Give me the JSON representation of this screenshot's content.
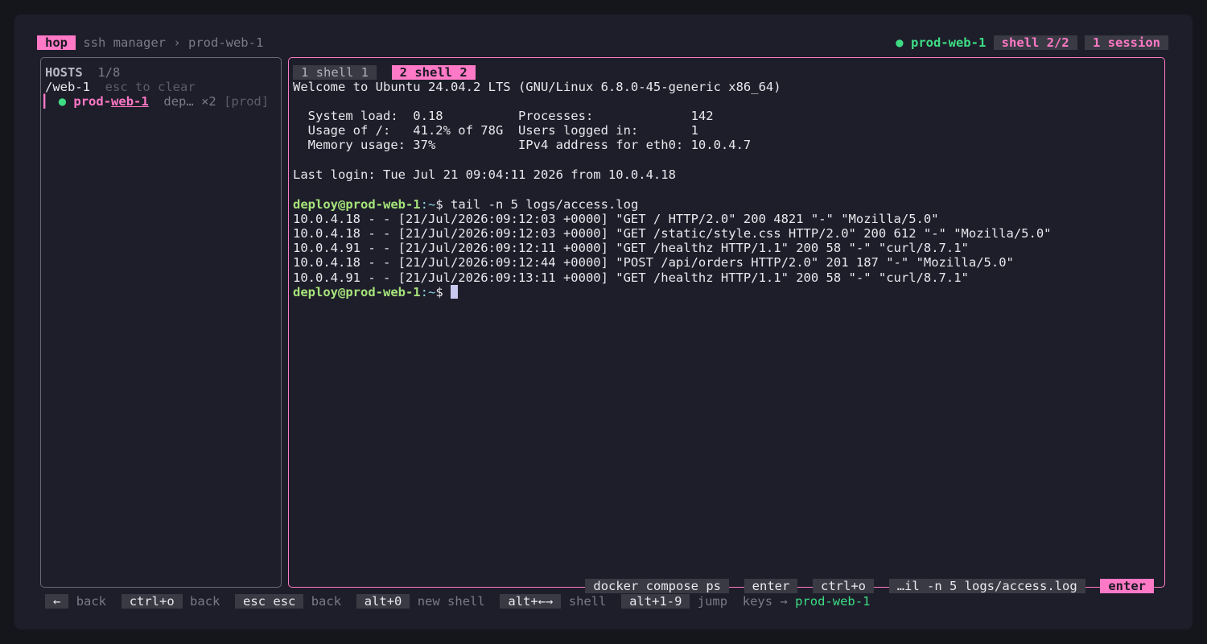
{
  "header": {
    "app_badge": "hop",
    "breadcrumb": "ssh manager › prod-web-1",
    "status_dot": "●",
    "host": "prod-web-1",
    "shell_count": "shell 2/2",
    "session_count": "1 session"
  },
  "hosts": {
    "title": "HOSTS",
    "count": "1/8",
    "filter": "/web-1",
    "filter_hint": "esc to clear",
    "items": [
      {
        "dot": "●",
        "name_prefix": "prod-",
        "name_match": "web-1",
        "user": "dep…",
        "sessions": "×2",
        "tag": "[prod]"
      }
    ]
  },
  "shells": {
    "tabs": [
      {
        "label": "1 shell 1",
        "active": false
      },
      {
        "label": "2 shell 2",
        "active": true
      }
    ]
  },
  "terminal": {
    "welcome": "Welcome to Ubuntu 24.04.2 LTS (GNU/Linux 6.8.0-45-generic x86_64)",
    "sysinfo": [
      "  System load:  0.18          Processes:             142",
      "  Usage of /:   41.2% of 78G  Users logged in:       1",
      "  Memory usage: 37%           IPv4 address for eth0: 10.0.4.7"
    ],
    "last_login": "Last login: Tue Jul 21 09:04:11 2026 from 10.0.4.18",
    "prompt_user": "deploy@prod-web-1",
    "prompt_path": ":~",
    "prompt_symbol": "$ ",
    "command": "tail -n 5 logs/access.log",
    "log_lines": [
      "10.0.4.18 - - [21/Jul/2026:09:12:03 +0000] \"GET / HTTP/2.0\" 200 4821 \"-\" \"Mozilla/5.0\"",
      "10.0.4.18 - - [21/Jul/2026:09:12:03 +0000] \"GET /static/style.css HTTP/2.0\" 200 612 \"-\" \"Mozilla/5.0\"",
      "10.0.4.91 - - [21/Jul/2026:09:12:11 +0000] \"GET /healthz HTTP/1.1\" 200 58 \"-\" \"curl/8.7.1\"",
      "10.0.4.18 - - [21/Jul/2026:09:12:44 +0000] \"POST /api/orders HTTP/2.0\" 201 187 \"-\" \"Mozilla/5.0\"",
      "10.0.4.91 - - [21/Jul/2026:09:13:11 +0000] \"GET /healthz HTTP/1.1\" 200 58 \"-\" \"curl/8.7.1\""
    ]
  },
  "history": {
    "items": [
      "docker compose ps",
      "enter",
      "ctrl+o",
      "…il -n 5 logs/access.log"
    ],
    "active": "enter"
  },
  "footer": {
    "keys": [
      {
        "key": "←",
        "desc": "back"
      },
      {
        "key": "ctrl+o",
        "desc": "back"
      },
      {
        "key": "esc esc",
        "desc": "back"
      },
      {
        "key": "alt+0",
        "desc": "new shell"
      },
      {
        "key": "alt+←→",
        "desc": "shell"
      },
      {
        "key": "alt+1-9",
        "desc": "jump"
      }
    ],
    "keys_target_prefix": "keys →",
    "keys_target": "prod-web-1"
  },
  "colors": {
    "accent": "#ff79c6",
    "status_green": "#3ddc84",
    "background": "#1e1e2a"
  }
}
